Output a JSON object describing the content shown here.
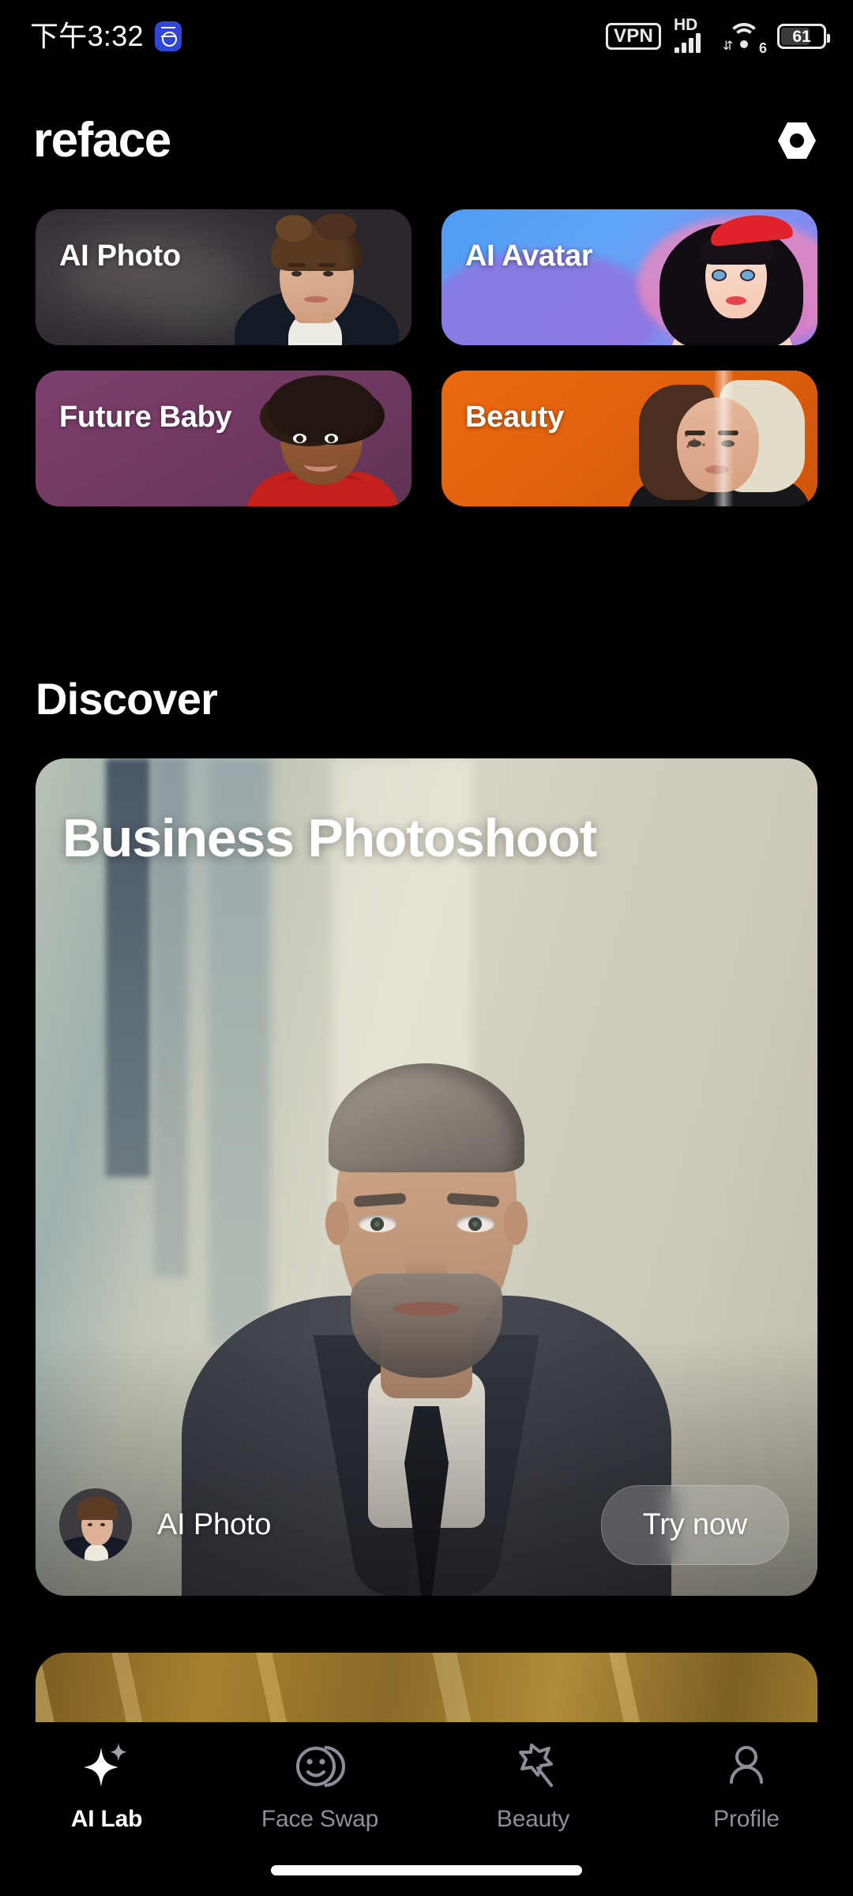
{
  "status_bar": {
    "time": "下午3:32",
    "app_badge_icon": "stopwatch-badge-icon",
    "vpn_label": "VPN",
    "hd_label": "HD",
    "signal_icon": "cellular-signal-icon",
    "wifi_icon": "wifi-icon",
    "wifi_generation": "6",
    "battery_percent": "61",
    "battery_icon": "battery-icon"
  },
  "header": {
    "logo_text": "reface",
    "gem_icon": "hexagon-gem-icon"
  },
  "feature_grid": {
    "cards": [
      {
        "label": "AI Photo",
        "accent": "#3a343b",
        "art": "young-man-portrait"
      },
      {
        "label": "AI Avatar",
        "accent": "#5f9ff6",
        "art": "cartoon-woman-avatar"
      },
      {
        "label": "Future Baby",
        "accent": "#733a64",
        "art": "smiling-child-portrait"
      },
      {
        "label": "Beauty",
        "accent": "#e2620f",
        "art": "before-after-woman-face"
      }
    ]
  },
  "discover": {
    "section_title": "Discover",
    "hero": {
      "title": "Business Photoshoot",
      "art": "businessman-in-suit-portrait",
      "avatar_icon": "ai-photo-thumbnail-avatar",
      "category_label": "AI Photo",
      "cta_label": "Try now"
    },
    "next_card_peek": {
      "art": "golden-texture-card"
    }
  },
  "bottom_nav": {
    "items": [
      {
        "label": "AI Lab",
        "icon": "sparkle-icon",
        "active": true
      },
      {
        "label": "Face Swap",
        "icon": "two-faces-icon",
        "active": false
      },
      {
        "label": "Beauty",
        "icon": "magic-wand-icon",
        "active": false
      },
      {
        "label": "Profile",
        "icon": "person-icon",
        "active": false
      }
    ]
  },
  "system": {
    "home_indicator": "home-indicator-bar"
  },
  "colors": {
    "background": "#000000",
    "text_primary": "#ffffff",
    "text_muted": "#8e8e9a",
    "avatar_blue": "#5f9ff6",
    "beauty_orange": "#e2620f",
    "baby_purple": "#733a64"
  }
}
